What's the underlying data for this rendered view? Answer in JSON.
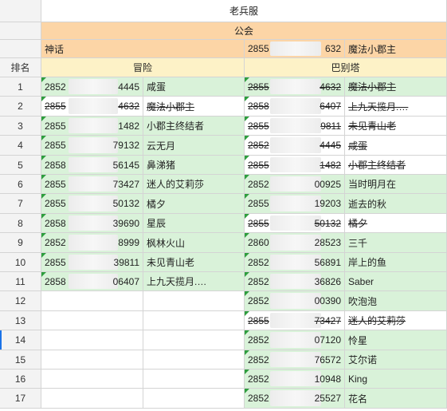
{
  "header": {
    "server_title": "老兵服",
    "guild_title": "公会",
    "guild_left_name": "神话",
    "guild_right_id_start": "2855",
    "guild_right_id_end": "632",
    "guild_right_name": "魔法小郡主",
    "rank_header": "排名",
    "adventure_header": "冒险",
    "tower_header": "巴别塔"
  },
  "rows": [
    {
      "rank": "1",
      "l_start": "2852",
      "l_end": "4445",
      "l_name": "咸蛋",
      "l_strike": false,
      "l_bg": "green",
      "r_start": "2855",
      "r_end": "4632",
      "r_name": "魔法小郡主",
      "r_strike": true,
      "r_bg": "green"
    },
    {
      "rank": "2",
      "l_start": "2855",
      "l_end": "4632",
      "l_name": "魔法小郡主",
      "l_strike": true,
      "l_bg": "white",
      "r_start": "2858",
      "r_end": "6407",
      "r_name": "上九天揽月.…",
      "r_strike": true,
      "r_bg": "white"
    },
    {
      "rank": "3",
      "l_start": "2855",
      "l_end": "1482",
      "l_name": "小郡主终结者",
      "l_strike": false,
      "l_bg": "green",
      "r_start": "2855",
      "r_end": "9811",
      "r_name": "未见青山老",
      "r_strike": true,
      "r_bg": "white"
    },
    {
      "rank": "4",
      "l_start": "2855",
      "l_end": "79132",
      "l_name": "云无月",
      "l_strike": false,
      "l_bg": "green",
      "r_start": "2852",
      "r_end": "4445",
      "r_name": "咸蛋",
      "r_strike": true,
      "r_bg": "white"
    },
    {
      "rank": "5",
      "l_start": "2858",
      "l_end": "56145",
      "l_name": "鼻涕猪",
      "l_strike": false,
      "l_bg": "green",
      "r_start": "2855",
      "r_end": "1482",
      "r_name": "小郡主终结者",
      "r_strike": true,
      "r_bg": "white"
    },
    {
      "rank": "6",
      "l_start": "2855",
      "l_end": "73427",
      "l_name": "迷人的艾莉莎",
      "l_strike": false,
      "l_bg": "green",
      "r_start": "2852",
      "r_end": "00925",
      "r_name": "当时明月在",
      "r_strike": false,
      "r_bg": "green"
    },
    {
      "rank": "7",
      "l_start": "2855",
      "l_end": "50132",
      "l_name": "橘夕",
      "l_strike": false,
      "l_bg": "green",
      "r_start": "2855",
      "r_end": "19203",
      "r_name": "逝去的秋",
      "r_strike": false,
      "r_bg": "green"
    },
    {
      "rank": "8",
      "l_start": "2858",
      "l_end": "39690",
      "l_name": "星辰",
      "l_strike": false,
      "l_bg": "green",
      "r_start": "2855",
      "r_end": "50132",
      "r_name": "橘夕",
      "r_strike": true,
      "r_bg": "white"
    },
    {
      "rank": "9",
      "l_start": "2852",
      "l_end": "8999",
      "l_name": "枫林火山",
      "l_strike": false,
      "l_bg": "green",
      "r_start": "2860",
      "r_end": "28523",
      "r_name": "三千",
      "r_strike": false,
      "r_bg": "green"
    },
    {
      "rank": "10",
      "l_start": "2855",
      "l_end": "39811",
      "l_name": "未见青山老",
      "l_strike": false,
      "l_bg": "green",
      "r_start": "2852",
      "r_end": "56891",
      "r_name": "岸上的鱼",
      "r_strike": false,
      "r_bg": "green"
    },
    {
      "rank": "11",
      "l_start": "2858",
      "l_end": "06407",
      "l_name": "上九天揽月.…",
      "l_strike": false,
      "l_bg": "green",
      "r_start": "2852",
      "r_end": "36826",
      "r_name": "Saber",
      "r_strike": false,
      "r_bg": "green"
    },
    {
      "rank": "12",
      "l_start": "",
      "l_end": "",
      "l_name": "",
      "l_strike": false,
      "l_bg": "white",
      "r_start": "2852",
      "r_end": "00390",
      "r_name": "吹泡泡",
      "r_strike": false,
      "r_bg": "green"
    },
    {
      "rank": "13",
      "l_start": "",
      "l_end": "",
      "l_name": "",
      "l_strike": false,
      "l_bg": "white",
      "r_start": "2855",
      "r_end": "73427",
      "r_name": "迷人的艾莉莎",
      "r_strike": true,
      "r_bg": "white"
    },
    {
      "rank": "14",
      "l_start": "",
      "l_end": "",
      "l_name": "",
      "l_strike": false,
      "l_bg": "white",
      "r_start": "2852",
      "r_end": "07120",
      "r_name": "怜星",
      "r_strike": false,
      "r_bg": "green"
    },
    {
      "rank": "15",
      "l_start": "",
      "l_end": "",
      "l_name": "",
      "l_strike": false,
      "l_bg": "white",
      "r_start": "2852",
      "r_end": "76572",
      "r_name": "艾尔诺",
      "r_strike": false,
      "r_bg": "green"
    },
    {
      "rank": "16",
      "l_start": "",
      "l_end": "",
      "l_name": "",
      "l_strike": false,
      "l_bg": "white",
      "r_start": "2852",
      "r_end": "10948",
      "r_name": "King",
      "r_strike": false,
      "r_bg": "green"
    },
    {
      "rank": "17",
      "l_start": "",
      "l_end": "",
      "l_name": "",
      "l_strike": false,
      "l_bg": "white",
      "r_start": "2852",
      "r_end": "25527",
      "r_name": "花名",
      "r_strike": false,
      "r_bg": "green"
    }
  ],
  "colors": {
    "header_orange": "#fcd5a6",
    "header_yellow": "#fdf2c7",
    "row_green": "#d9f2d9",
    "grid_line": "#d4d4d4",
    "comment_marker": "#2e9e3e",
    "selected_row_marker": "#1a73e8"
  },
  "selected_row_rank": "14"
}
